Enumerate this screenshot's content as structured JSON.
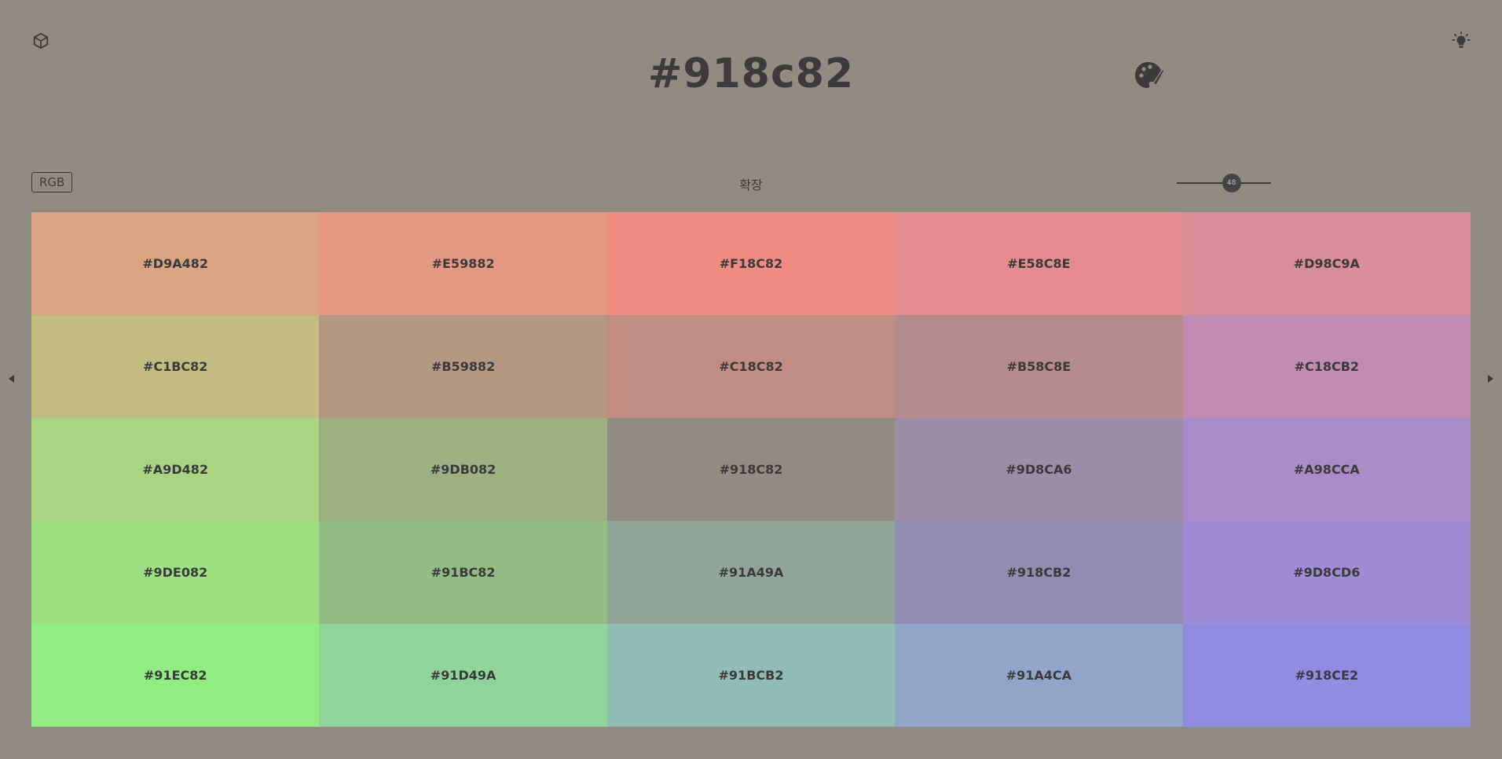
{
  "header": {
    "title": "#918c82",
    "left_icon": "cube-icon",
    "right_icon": "lightbulb-icon",
    "palette_icon": "palette-icon"
  },
  "controls": {
    "mode_label": "RGB",
    "center_label": "확장",
    "slider_value": "48",
    "slider_fraction": 0.48
  },
  "navigation": {
    "prev_icon": "triangle-left-icon",
    "next_icon": "triangle-right-icon"
  },
  "colors": {
    "background": "#918c82",
    "text": "#3b3b3b"
  },
  "swatches": [
    [
      "#D9A482",
      "#E59882",
      "#F18C82",
      "#E58C8E",
      "#D98C9A"
    ],
    [
      "#C1BC82",
      "#B59882",
      "#C18C82",
      "#B58C8E",
      "#C18CB2"
    ],
    [
      "#A9D482",
      "#9DB082",
      "#918C82",
      "#9D8CA6",
      "#A98CCA"
    ],
    [
      "#9DE082",
      "#91BC82",
      "#91A49A",
      "#918CB2",
      "#9D8CD6"
    ],
    [
      "#91EC82",
      "#91D49A",
      "#91BCB2",
      "#91A4CA",
      "#918CE2"
    ]
  ]
}
